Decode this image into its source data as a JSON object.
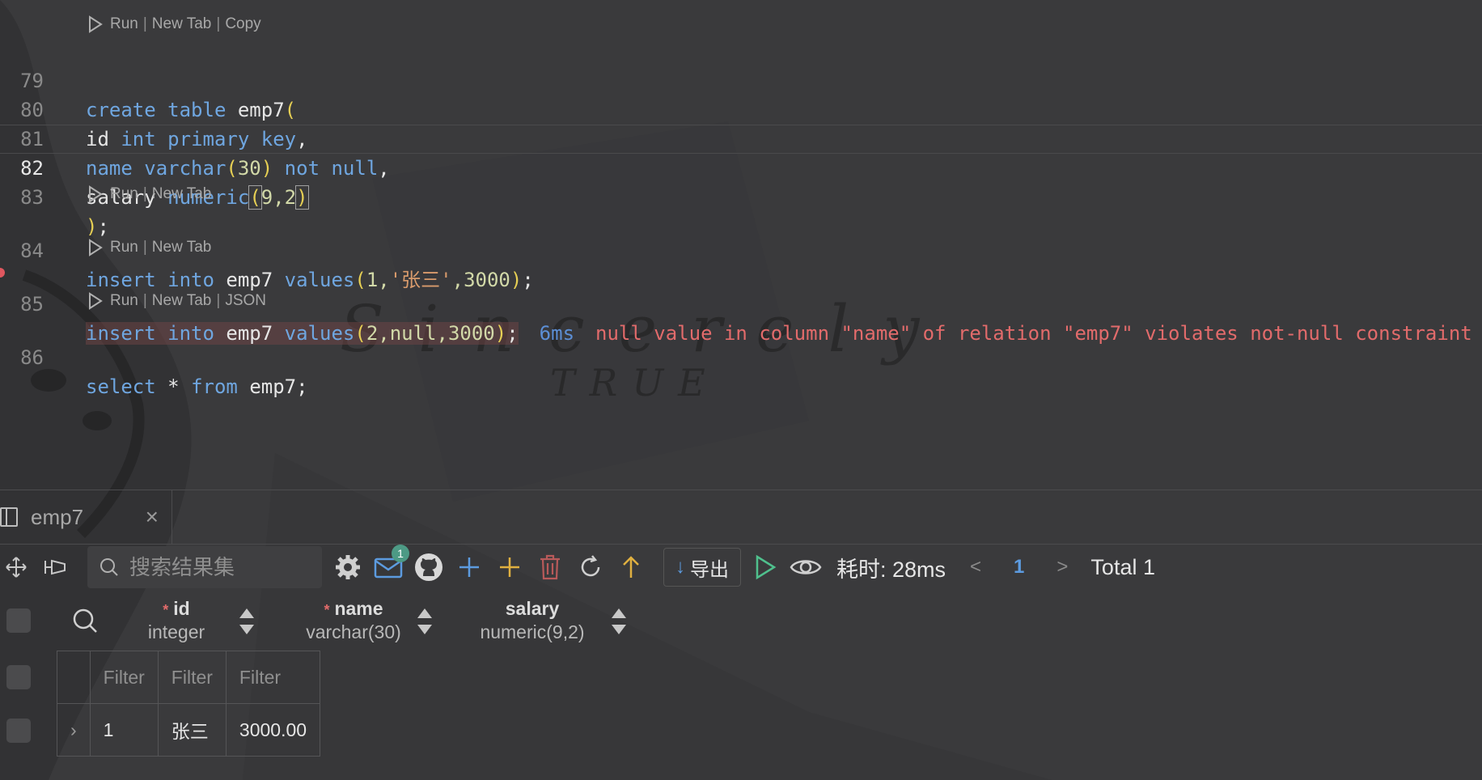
{
  "editor": {
    "lines": [
      {
        "num": "79",
        "active": false
      },
      {
        "num": "80",
        "active": false
      },
      {
        "num": "81",
        "active": false
      },
      {
        "num": "82",
        "active": true
      },
      {
        "num": "83",
        "active": false
      },
      {
        "num": "84",
        "active": false
      },
      {
        "num": "85",
        "active": false
      },
      {
        "num": "86",
        "active": false
      }
    ],
    "code": {
      "l79": [
        "create",
        "table",
        "emp7",
        "("
      ],
      "l80": [
        "id",
        "int",
        "primary",
        "key",
        ","
      ],
      "l81": [
        "name",
        "varchar",
        "(",
        "30",
        ")",
        "not",
        "null",
        ","
      ],
      "l82": [
        "salary",
        "numeric",
        "(",
        "9,2",
        ")"
      ],
      "l83": [
        ")",
        ";"
      ],
      "l84": [
        "insert",
        "into",
        "emp7",
        "values",
        "(",
        "1,",
        "'张三'",
        ",3000",
        ")",
        ";"
      ],
      "l85": [
        "insert",
        "into",
        "emp7",
        "values",
        "(",
        "2,null,3000",
        ")",
        ";"
      ],
      "l86": [
        "select",
        "*",
        "from",
        "emp7;"
      ]
    },
    "error_timing": "6ms",
    "error_message": "null value in column \"name\" of relation \"emp7\" violates not-null constraint",
    "lenses": {
      "lens1": {
        "run": "Run",
        "new_tab": "New Tab",
        "extra": "Copy"
      },
      "lens2": {
        "run": "Run",
        "new_tab": "New Tab"
      },
      "lens3": {
        "run": "Run",
        "new_tab": "New Tab"
      },
      "lens4": {
        "run": "Run",
        "new_tab": "New Tab",
        "extra": "JSON"
      }
    },
    "separator": "|"
  },
  "watermark": {
    "line1": "Sincerely",
    "line2": "TRUE"
  },
  "results": {
    "tab_label": "emp7",
    "tab_close": "×",
    "search_placeholder": "搜索结果集",
    "mail_badge": "1",
    "export_label": "导出",
    "export_arrow": "↓",
    "timing": "耗时: 28ms",
    "page": "1",
    "prev": "<",
    "next": ">",
    "total": "Total 1",
    "columns": [
      {
        "name": "id",
        "type": "integer",
        "required": true
      },
      {
        "name": "name",
        "type": "varchar(30)",
        "required": true
      },
      {
        "name": "salary",
        "type": "numeric(9,2)",
        "required": false
      }
    ],
    "required_mark": "*",
    "filter_placeholder": "Filter",
    "rows": [
      {
        "expander": "›",
        "id": "1",
        "name": "张三",
        "salary": "3000.00"
      }
    ]
  },
  "colors": {
    "keyword": "#6fa6e0",
    "error": "#e26b6b",
    "accent": "#5c9be0",
    "run": "#4fc08d"
  }
}
